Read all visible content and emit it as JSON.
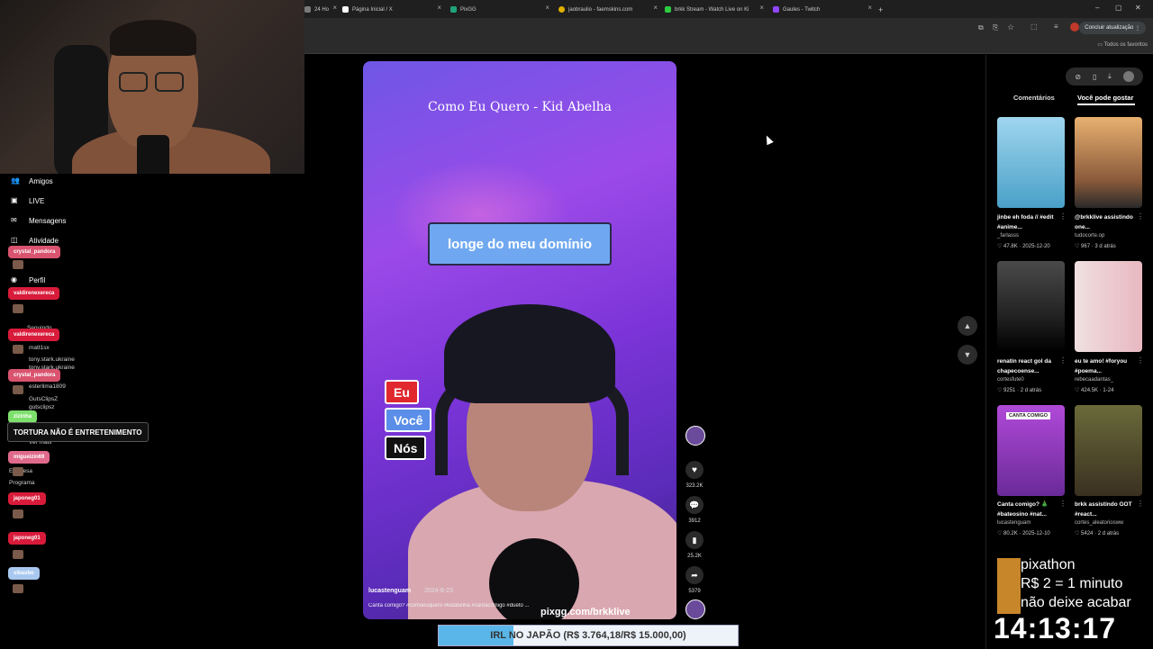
{
  "browser": {
    "tabs": [
      {
        "label": "24 Ho",
        "color": "#7a7a7a"
      },
      {
        "label": "Página Inicial / X",
        "color": "#ffffff"
      },
      {
        "label": "PixGG",
        "color": "#1fa37a"
      },
      {
        "label": "jaobraulio - faemskins.com",
        "color": "#e0b000"
      },
      {
        "label": "brkk Stream - Watch Live on Ki",
        "color": "#2ecc40"
      },
      {
        "label": "Gaules - Twitch",
        "color": "#9146ff"
      }
    ],
    "new_tab": "+",
    "update_button": "Concluir atualização",
    "favorites_label": "Todos os favoritos"
  },
  "left_nav": {
    "items": [
      {
        "label": "Amigos"
      },
      {
        "label": "LIVE"
      },
      {
        "label": "Mensagens"
      },
      {
        "label": "Atividade"
      },
      {
        "label": "Perfil"
      }
    ]
  },
  "chat": {
    "names": [
      {
        "label": "crystal_pandora",
        "color": "#d9536f"
      },
      {
        "label": "valdirenexereca",
        "color": "#d81b3a"
      },
      {
        "label": "valdirenexereca",
        "color": "#d81b3a"
      },
      {
        "label": "crystal_pandora",
        "color": "#d9536f"
      },
      {
        "label": "zizinha",
        "color": "#7ee06c"
      },
      {
        "label": "migueizin69",
        "color": "#e06a8c"
      },
      {
        "label": "japoneg01",
        "color": "#d81b3a"
      },
      {
        "label": "japoneg01",
        "color": "#d81b3a"
      },
      {
        "label": "sibasbo",
        "color": "#a9c8f0"
      }
    ],
    "ghost_lines": [
      "Seguindo",
      "matt1sx",
      "tony.stark.ukraine",
      "tony.stark.ukraine",
      "esterlima1809",
      "GutsClipsZ",
      "gutsclipsz",
      "Ver mais",
      "Empresa",
      "Programa"
    ],
    "banner": "TORTURA NÃO É ENTRETENIMENTO"
  },
  "video": {
    "song_title": "Como Eu Quero - Kid Abelha",
    "lyric": "longe do meu domínio",
    "parts": [
      {
        "label": "Eu",
        "color": "#e0282e"
      },
      {
        "label": "Você",
        "color": "#5b8ee8"
      },
      {
        "label": "Nós",
        "color": "#111111"
      }
    ],
    "username": "lucastenguam",
    "date": "2024-8-23",
    "caption": "Canta comigo? #comoeuquero #kidabelha #cantacomigo #dueto ...",
    "watermark": "pixgg.com/brkklive"
  },
  "actions": {
    "likes": "323.2K",
    "comments": "3912",
    "saves": "25.2K",
    "shares": "5379"
  },
  "right_panel": {
    "tabs": [
      "Comentários",
      "Você pode gostar"
    ],
    "cards": [
      {
        "title": "jinbe eh foda // #edit #anime...",
        "user": "_farlasss",
        "likes": "47.8K",
        "date": "2025-12-20",
        "thumb": "#6ab0d8"
      },
      {
        "title": "@brkklive assistindo one...",
        "user": "tudocorte.op",
        "likes": "967",
        "date": "3 d atrás",
        "thumb": "#d89a5a"
      },
      {
        "title": "renatin react gol da chapecoense...",
        "user": "cortesfute0",
        "likes": "9251",
        "date": "2 d atrás",
        "thumb": "#3a3a3a"
      },
      {
        "title": "eu te amo! #foryou #poema...",
        "user": "rebecaadantas_",
        "likes": "424.5K",
        "date": "1-24",
        "thumb": "#e6c8c8"
      },
      {
        "title": "Canta comigo? 🎄 #bateosino #nat...",
        "user": "lucastenguam",
        "likes": "80.2K",
        "date": "2025-12-10",
        "thumb": "#8a3ab8",
        "badge": "CANTA COMIGO"
      },
      {
        "title": "brkk assistindo GOT #react...",
        "user": "cortes_aleatoriosww",
        "likes": "5424",
        "date": "2 d atrás",
        "thumb": "#5a5a3a"
      }
    ]
  },
  "overlays": {
    "pixathon_lines": [
      "pixathon",
      "R$ 2 = 1 minuto",
      "não deixe acabar"
    ],
    "clock": "14:13:17",
    "goal_text": "IRL NO JAPÃO (R$ 3.764,18/R$ 15.000,00)",
    "goal_progress": 0.251
  }
}
